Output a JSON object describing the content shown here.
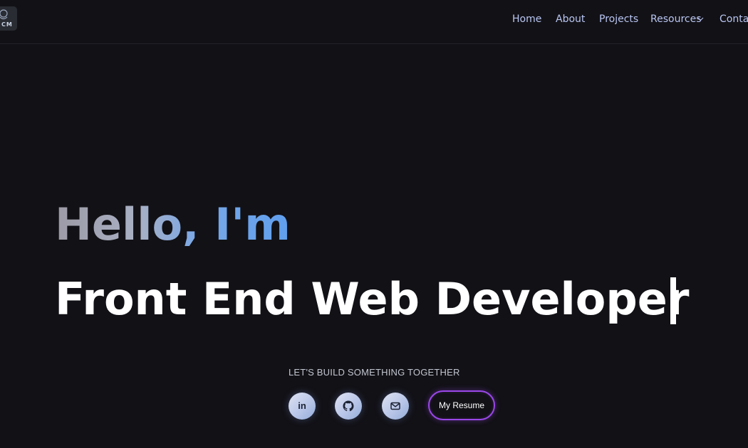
{
  "header": {
    "logo_text": "CM",
    "nav": {
      "home": "Home",
      "about": "About",
      "projects": "Projects",
      "resources": "Resources",
      "contact": "Contac"
    },
    "resources_icon": "chevron-down-icon"
  },
  "hero": {
    "greeting": "Hello, I'm",
    "role": "Front End Web Developer",
    "tagline": "LET'S BUILD SOMETHING TOGETHER",
    "linkedin_label": "in",
    "resume_label": "My Resume"
  },
  "colors": {
    "background": "#121116",
    "nav_text": "#b9c6f2",
    "resume_border": "#9a47e8",
    "social_bg": "#c4cee9"
  },
  "icons": [
    "linkedin-icon",
    "github-icon",
    "mail-icon",
    "chevron-down-icon"
  ]
}
